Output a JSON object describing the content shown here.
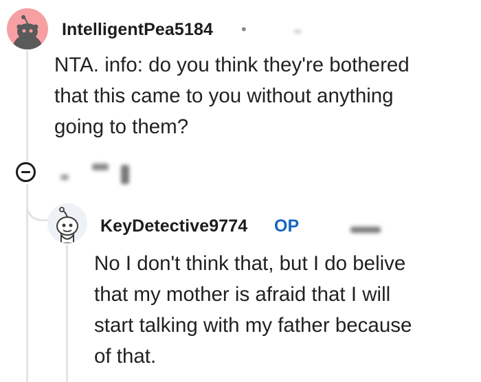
{
  "comment_1": {
    "username": "IntelligentPea5184",
    "separator": "•",
    "body_lines": [
      "NTA. info: do you think they're bothered",
      "that this came to you without anything",
      "going to them?"
    ],
    "avatar_icon": "snoo-avatar-icon"
  },
  "actions": {
    "collapse_icon": "collapse-minus-icon"
  },
  "reply": {
    "username": "KeyDetective9774",
    "op_badge": "OP",
    "body_lines": [
      "No I don't think that, but I do belive",
      "that my mother is afraid that I will",
      "start talking with my father because",
      "of that."
    ],
    "avatar_icon": "snoo-avatar-icon"
  },
  "colors": {
    "avatar_1_bg": "#f6a0a4",
    "op_badge": "#1565c0",
    "thread_line": "#e4e4e4"
  }
}
